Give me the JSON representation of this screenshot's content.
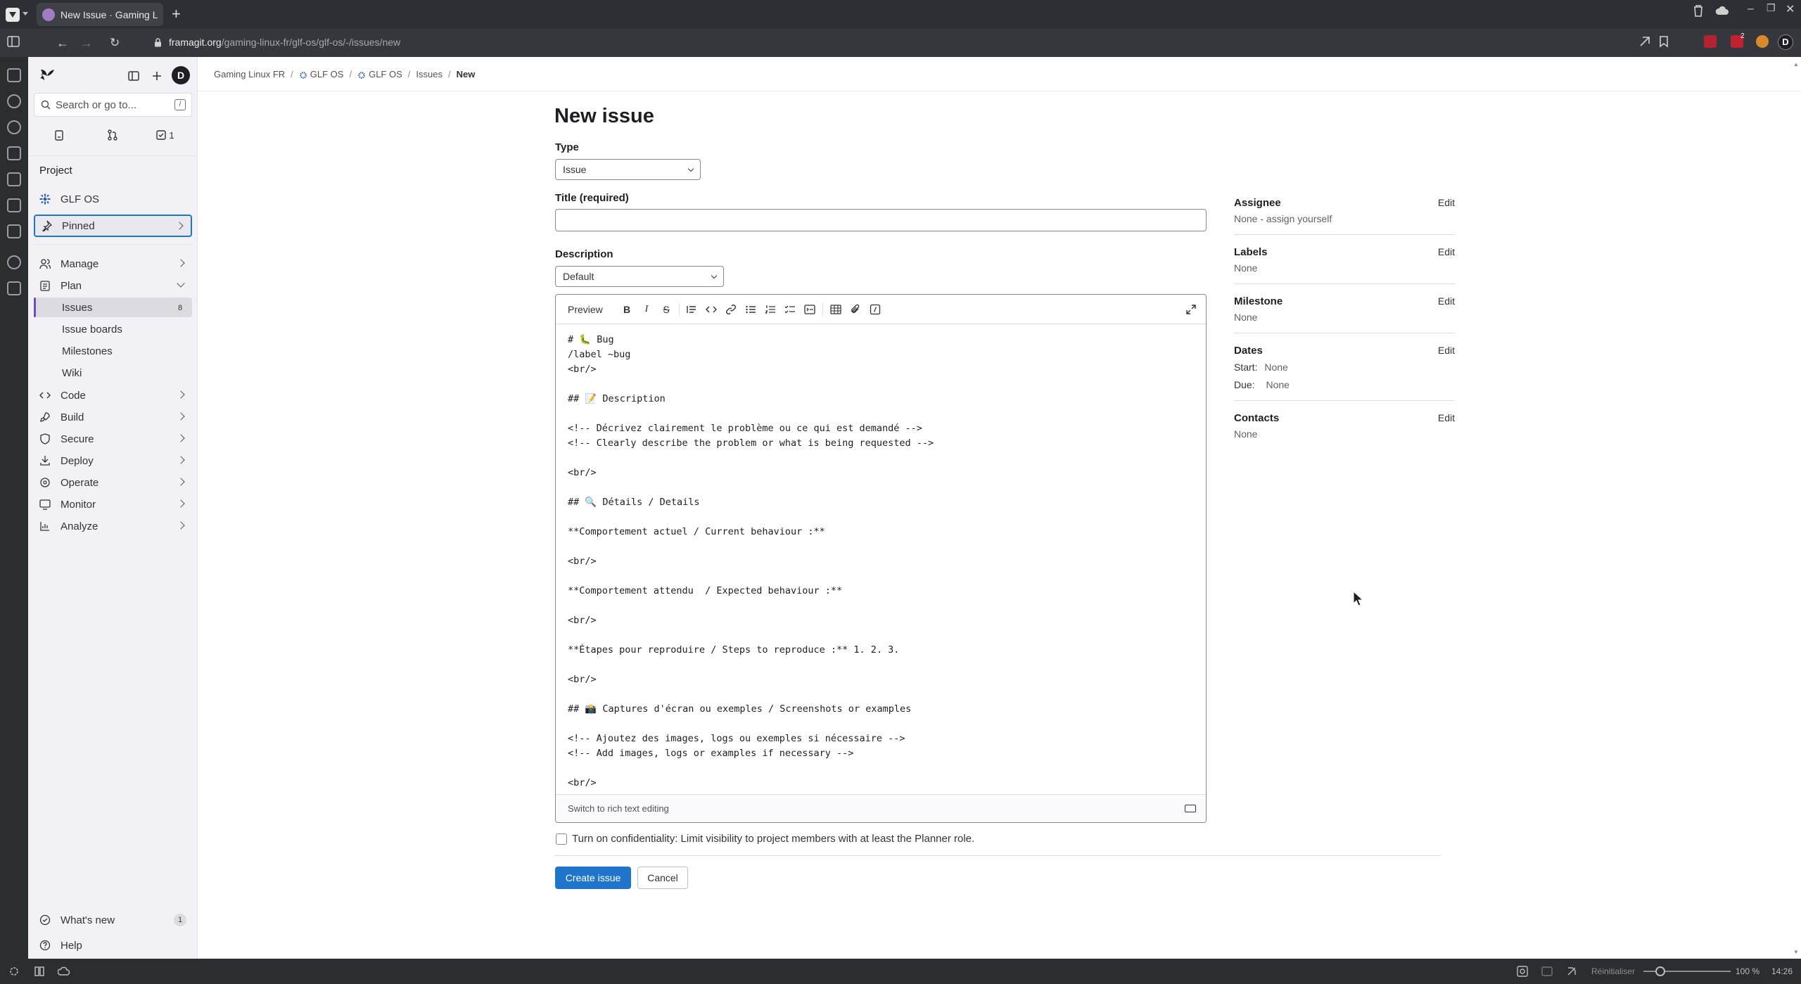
{
  "browser": {
    "tab_title": "New Issue · Gaming Linux F",
    "url_host": "framagit.org",
    "url_path": "/gaming-linux-fr/glf-os/glf-os/-/issues/new",
    "extension_badge": "2",
    "profile_initial": "D"
  },
  "statusbar": {
    "reset_label": "Réinitialiser",
    "zoom": "100 %",
    "time": "14:26"
  },
  "sidebar": {
    "avatar_initial": "D",
    "search_placeholder": "Search or go to...",
    "search_shortcut": "/",
    "todo_count": "1",
    "project_heading": "Project",
    "project_name": "GLF OS",
    "pinned_label": "Pinned",
    "items": [
      {
        "label": "Manage"
      },
      {
        "label": "Plan"
      },
      {
        "label": "Code"
      },
      {
        "label": "Build"
      },
      {
        "label": "Secure"
      },
      {
        "label": "Deploy"
      },
      {
        "label": "Operate"
      },
      {
        "label": "Monitor"
      },
      {
        "label": "Analyze"
      }
    ],
    "plan_sub": [
      {
        "label": "Issues",
        "count": "8"
      },
      {
        "label": "Issue boards"
      },
      {
        "label": "Milestones"
      },
      {
        "label": "Wiki"
      }
    ],
    "whats_new": "What's new",
    "whats_new_count": "1",
    "help": "Help"
  },
  "breadcrumb": [
    "Gaming Linux FR",
    "GLF OS",
    "GLF OS",
    "Issues",
    "New"
  ],
  "form": {
    "page_title": "New issue",
    "type_label": "Type",
    "type_value": "Issue",
    "title_label": "Title (required)",
    "title_value": "",
    "description_label": "Description",
    "template_value": "Default",
    "preview_label": "Preview",
    "description_text": "# 🐛 Bug\n/label ~bug\n<br/>\n\n## 📝 Description\n\n<!-- Décrivez clairement le problème ou ce qui est demandé -->\n<!-- Clearly describe the problem or what is being requested -->\n\n<br/>\n\n## 🔍 Détails / Details\n\n**Comportement actuel / Current behaviour :**\n\n<br/>\n\n**Comportement attendu  / Expected behaviour :**\n\n<br/>\n\n**Étapes pour reproduire / Steps to reproduce :** 1. 2. 3.\n\n<br/>\n\n## 📸 Captures d'écran ou exemples / Screenshots or examples\n\n<!-- Ajoutez des images, logs ou exemples si nécessaire -->\n<!-- Add images, logs or examples if necessary -->\n\n<br/>",
    "rich_text_link": "Switch to rich text editing",
    "confidential_label": "Turn on confidentiality: Limit visibility to project members with at least the Planner role.",
    "create_button": "Create issue",
    "cancel_button": "Cancel"
  },
  "attributes": {
    "edit_label": "Edit",
    "assignee": {
      "title": "Assignee",
      "value": "None - assign yourself"
    },
    "labels": {
      "title": "Labels",
      "value": "None"
    },
    "milestone": {
      "title": "Milestone",
      "value": "None"
    },
    "dates": {
      "title": "Dates",
      "start_label": "Start:",
      "start_value": "None",
      "due_label": "Due:",
      "due_value": "None"
    },
    "contacts": {
      "title": "Contacts",
      "value": "None"
    }
  },
  "colors": {
    "primary_button": "#1f75cb",
    "sidebar_bg": "#f2f1f5",
    "active_indicator": "#6b4fbb",
    "focus_ring": "#1f75cb"
  }
}
